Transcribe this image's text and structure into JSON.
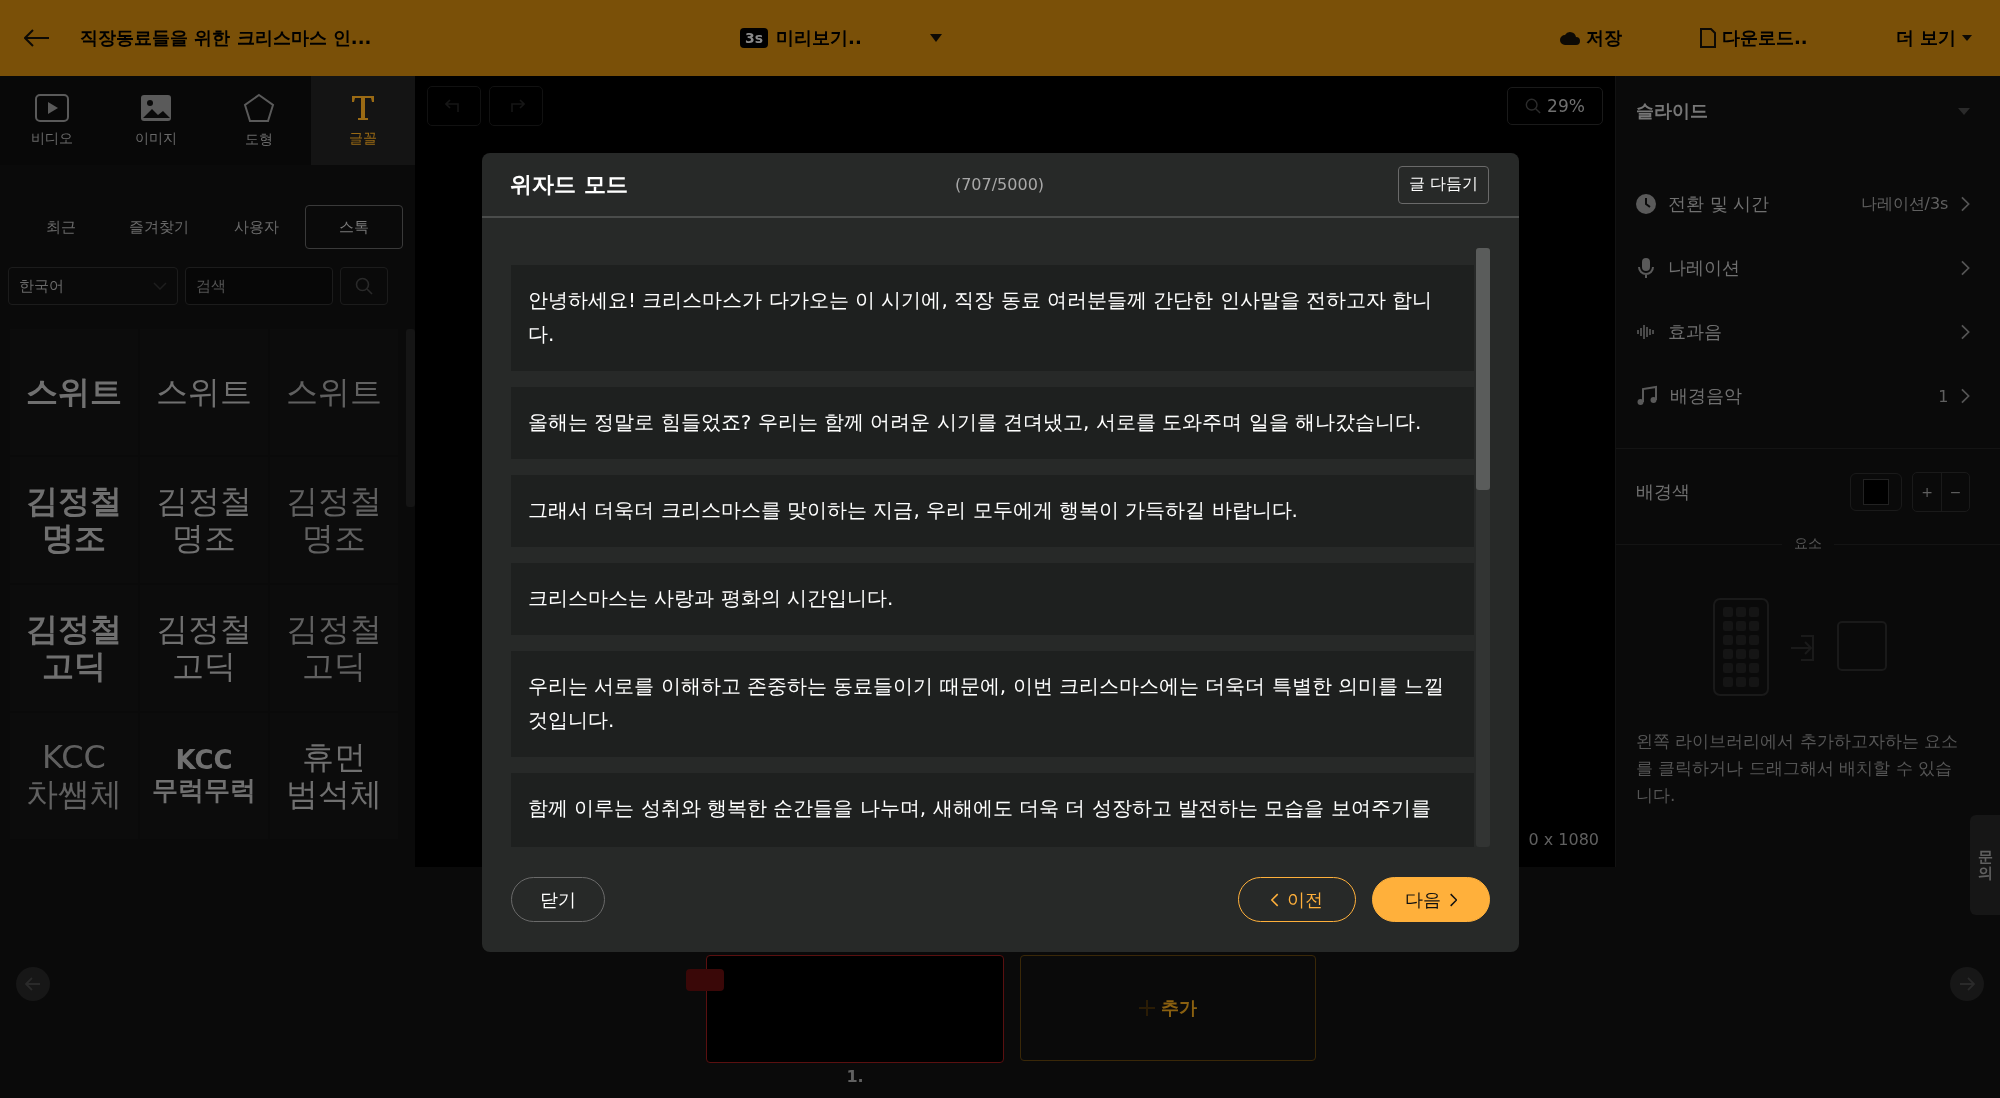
{
  "top_bar": {
    "title": "직장동료들을 위한 크리스마스 인...",
    "preview_badge": "3s",
    "preview": "미리보기..",
    "save": "저장",
    "download": "다운로드..",
    "more": "더 보기"
  },
  "left_panel": {
    "asset_tabs": [
      {
        "label": "비디오",
        "selected": false
      },
      {
        "label": "이미지",
        "selected": false
      },
      {
        "label": "도형",
        "selected": false
      },
      {
        "label": "글꼴",
        "selected": true
      }
    ],
    "font_tabs": [
      {
        "label": "최근",
        "selected": false
      },
      {
        "label": "즐겨찾기",
        "selected": false
      },
      {
        "label": "사용자",
        "selected": false
      },
      {
        "label": "스톡",
        "selected": true
      }
    ],
    "language": "한국어",
    "search_placeholder": "검색",
    "fonts": [
      "스위트",
      "스위트",
      "스위트",
      "김정철\n명조",
      "김정철\n명조",
      "김정철\n명조",
      "김정철\n고딕",
      "김정철\n고딕",
      "김정철\n고딕",
      "KCC\n차쌤체",
      "KCC\n무럭무럭",
      "휴먼\n범석체"
    ]
  },
  "canvas": {
    "zoom": "29%",
    "size": "0 x 1080"
  },
  "slides": {
    "items": [
      {
        "number": "1.",
        "selected": true
      }
    ],
    "add": "추가"
  },
  "right_panel": {
    "title": "슬라이드",
    "rows": [
      {
        "label": "전환 및 시간",
        "value": "나레이션/3s"
      },
      {
        "label": "나레이션"
      },
      {
        "label": "효과음"
      },
      {
        "label": "배경음악",
        "value": "1"
      }
    ],
    "background_label": "배경색",
    "plus": "+",
    "minus": "−",
    "elements_label": "요소",
    "hint": "왼쪽 라이브러리에서 추가하고자하는 요소를 클릭하거나 드래그해서 배치할 수 있습니다."
  },
  "help_tab": "문의",
  "modal": {
    "title": "위자드 모드",
    "counter": "(707/5000)",
    "polish": "글 다듬기",
    "paragraphs": [
      "안녕하세요! 크리스마스가 다가오는 이 시기에, 직장 동료 여러분들께 간단한 인사말을 전하고자 합니다.",
      "올해는 정말로 힘들었죠? 우리는 함께 어려운 시기를 견뎌냈고, 서로를 도와주며 일을 해나갔습니다.",
      "그래서 더욱더 크리스마스를 맞이하는 지금, 우리 모두에게 행복이 가득하길 바랍니다.",
      "크리스마스는 사랑과 평화의 시간입니다.",
      "우리는 서로를 이해하고 존중하는 동료들이기 때문에, 이번 크리스마스에는 더욱더 특별한 의미를 느낄 것입니다.",
      "함께 이루는 성취와 행복한 순간들을 나누며, 새해에도 더욱 더 성장하고 발전하는 모습을 보여주기를"
    ],
    "close": "닫기",
    "prev": "이전",
    "next": "다음"
  }
}
